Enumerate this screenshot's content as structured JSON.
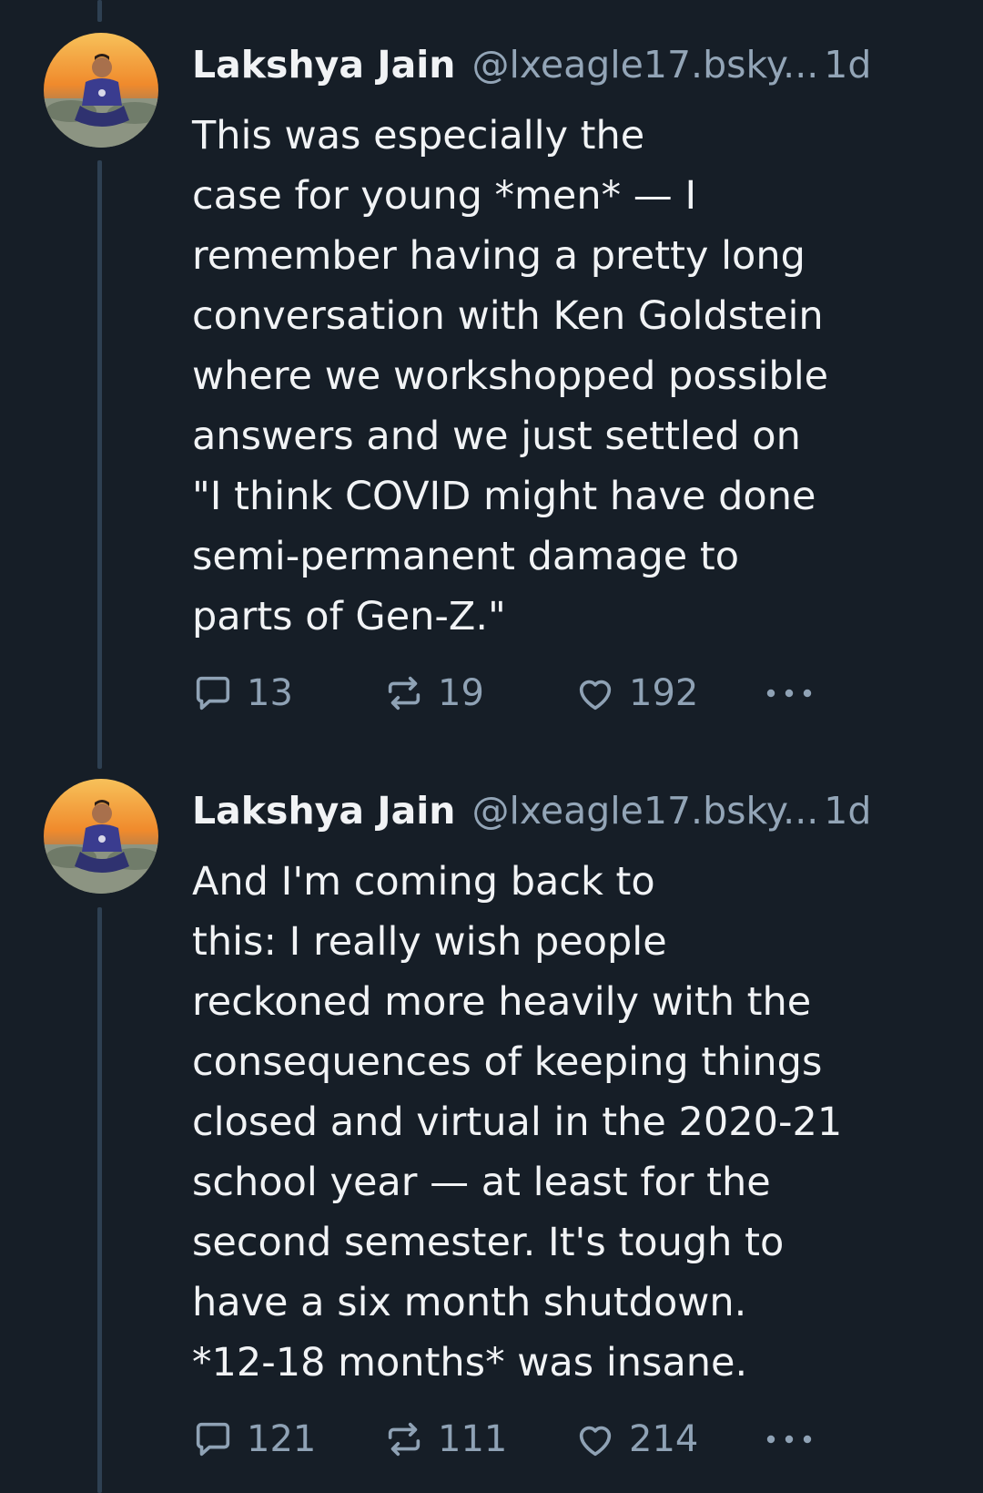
{
  "posts": [
    {
      "author_name": "Lakshya Jain",
      "author_handle": "@lxeagle17.bsky...",
      "time": "1d",
      "body_lines": [
        "This was especially the",
        "case for young *men* — I",
        "remember having a pretty long",
        "conversation with Ken Goldstein",
        "where we workshopped possible",
        "answers and we just settled on",
        "\"I think COVID might have done",
        "semi-permanent damage to",
        "parts of Gen-Z.\""
      ],
      "reply_count": "13",
      "repost_count": "19",
      "like_count": "192"
    },
    {
      "author_name": "Lakshya Jain",
      "author_handle": "@lxeagle17.bsky...",
      "time": "1d",
      "body_lines": [
        "And I'm coming back to",
        "this: I really wish people",
        "reckoned more heavily with the",
        "consequences of keeping things",
        "closed and virtual in the 2020-21",
        "school year — at least for the",
        "second semester. It's tough to",
        "have a six month shutdown.",
        "*12-18 months* was insane."
      ],
      "reply_count": "121",
      "repost_count": "111",
      "like_count": "214"
    }
  ],
  "icons": {
    "reply": "speech-bubble-icon",
    "repost": "repost-arrows-icon",
    "like": "heart-outline-icon",
    "more": "ellipsis-icon"
  },
  "colors": {
    "background": "#161e27",
    "thread_line": "#2e4052",
    "text": "#f1f3f5",
    "muted": "#93a5b7"
  }
}
